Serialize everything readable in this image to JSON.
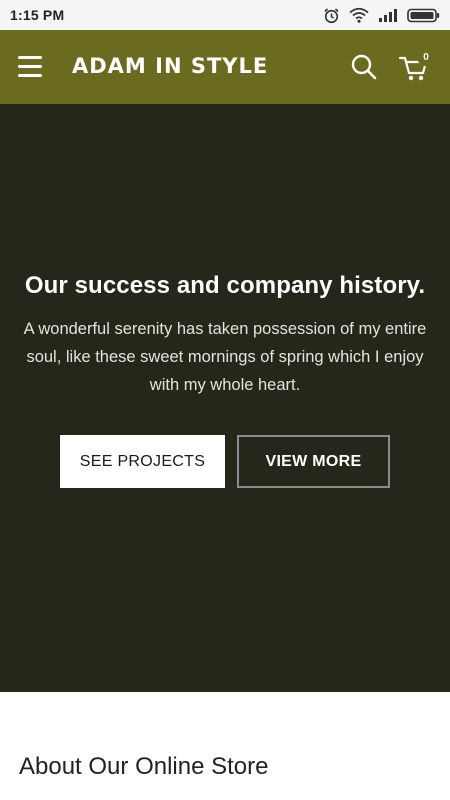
{
  "status_bar": {
    "time": "1:15 PM",
    "icons": [
      "alarm-icon",
      "wifi-icon",
      "signal-icon",
      "battery-icon"
    ]
  },
  "header": {
    "brand": "ADAM IN STYLE",
    "cart_count": "0",
    "icons": [
      "menu-icon",
      "search-icon",
      "cart-icon"
    ],
    "background_color": "#6b6b1f"
  },
  "hero": {
    "title": "Our success and company history.",
    "text": "A wonderful serenity has taken possession of my entire soul, like these sweet mornings of spring which I enjoy with my whole heart.",
    "primary_button": "SEE PROJECTS",
    "secondary_button": "VIEW MORE",
    "background_color": "#25271a"
  },
  "about": {
    "title": "About Our Online Store"
  }
}
